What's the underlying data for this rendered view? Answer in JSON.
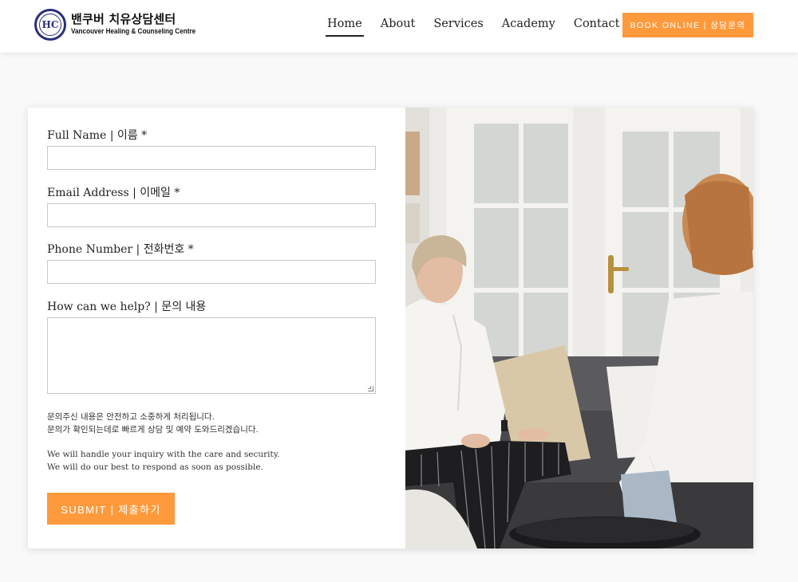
{
  "header": {
    "logo": {
      "monogram": "HC",
      "name_kr": "밴쿠버 치유상담센터",
      "name_en": "Vancouver Healing & Counseling Centre"
    },
    "nav": [
      {
        "label": "Home",
        "active": true
      },
      {
        "label": "About",
        "active": false
      },
      {
        "label": "Services",
        "active": false
      },
      {
        "label": "Academy",
        "active": false
      },
      {
        "label": "Contact",
        "active": false
      }
    ],
    "book_button": "BOOK ONLINE  |  상담문의"
  },
  "form": {
    "full_name": {
      "label": "Full Name | 이름 *",
      "value": ""
    },
    "email": {
      "label": "Email Address | 이메일 *",
      "value": ""
    },
    "phone": {
      "label": "Phone Number | 전화번호 *",
      "value": ""
    },
    "message": {
      "label": "How can we help? | 문의 내용",
      "value": ""
    },
    "note_kr_1": "문의주신 내용은 안전하고 소중하게 처리됩니다.",
    "note_kr_2": "문의가 확인되는데로 빠르게 상담 및 예약 도와드리겠습니다.",
    "note_en_1": "We will handle your inquiry with the care and security.",
    "note_en_2": "We will do our best to respond as soon as possible.",
    "submit_button": "SUBMIT  |  제출하기"
  },
  "photo": {
    "icon": "counseling-session-photo"
  },
  "colors": {
    "accent": "#ff9a3c",
    "logo_navy": "#2b2f7a",
    "page_bg": "#f9f9f9"
  }
}
